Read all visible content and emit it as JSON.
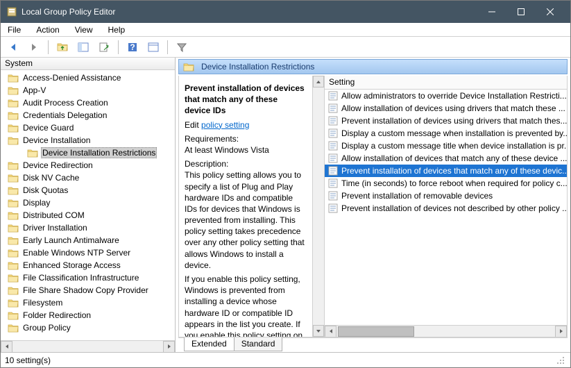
{
  "window": {
    "title": "Local Group Policy Editor"
  },
  "menu": {
    "items": [
      "File",
      "Action",
      "View",
      "Help"
    ]
  },
  "tree": {
    "header": "System",
    "items": [
      {
        "label": "Access-Denied Assistance",
        "depth": 0
      },
      {
        "label": "App-V",
        "depth": 0
      },
      {
        "label": "Audit Process Creation",
        "depth": 0
      },
      {
        "label": "Credentials Delegation",
        "depth": 0
      },
      {
        "label": "Device Guard",
        "depth": 0
      },
      {
        "label": "Device Installation",
        "depth": 0
      },
      {
        "label": "Device Installation Restrictions",
        "depth": 1,
        "selected": true
      },
      {
        "label": "Device Redirection",
        "depth": 0
      },
      {
        "label": "Disk NV Cache",
        "depth": 0
      },
      {
        "label": "Disk Quotas",
        "depth": 0
      },
      {
        "label": "Display",
        "depth": 0
      },
      {
        "label": "Distributed COM",
        "depth": 0
      },
      {
        "label": "Driver Installation",
        "depth": 0
      },
      {
        "label": "Early Launch Antimalware",
        "depth": 0
      },
      {
        "label": "Enable Windows NTP Server",
        "depth": 0
      },
      {
        "label": "Enhanced Storage Access",
        "depth": 0
      },
      {
        "label": "File Classification Infrastructure",
        "depth": 0
      },
      {
        "label": "File Share Shadow Copy Provider",
        "depth": 0
      },
      {
        "label": "Filesystem",
        "depth": 0
      },
      {
        "label": "Folder Redirection",
        "depth": 0
      },
      {
        "label": "Group Policy",
        "depth": 0
      }
    ]
  },
  "detail": {
    "header": "Device Installation Restrictions",
    "title": "Prevent installation of devices that match any of these device IDs",
    "edit_label": "Edit",
    "policy_link": "policy setting",
    "req_heading": "Requirements:",
    "requirements": "At least Windows Vista",
    "desc_heading": "Description:",
    "description_p1": "This policy setting allows you to specify a list of Plug and Play hardware IDs and compatible IDs for devices that Windows is prevented from installing. This policy setting takes precedence over any other policy setting that allows Windows to install a device.",
    "description_p2": "If you enable this policy setting, Windows is prevented from installing a device whose hardware ID or compatible ID appears in the list you create. If you enable this policy setting on a"
  },
  "settings": {
    "column": "Setting",
    "items": [
      {
        "label": "Allow administrators to override Device Installation Restricti..."
      },
      {
        "label": "Allow installation of devices using drivers that match these ..."
      },
      {
        "label": "Prevent installation of devices using drivers that match thes..."
      },
      {
        "label": "Display a custom message when installation is prevented by..."
      },
      {
        "label": "Display a custom message title when device installation is pr..."
      },
      {
        "label": "Allow installation of devices that match any of these device ..."
      },
      {
        "label": "Prevent installation of devices that match any of these devic...",
        "selected": true
      },
      {
        "label": "Time (in seconds) to force reboot when required for policy c..."
      },
      {
        "label": "Prevent installation of removable devices"
      },
      {
        "label": "Prevent installation of devices not described by other policy ..."
      }
    ]
  },
  "tabs": {
    "extended": "Extended",
    "standard": "Standard"
  },
  "status": {
    "text": "10 setting(s)"
  }
}
